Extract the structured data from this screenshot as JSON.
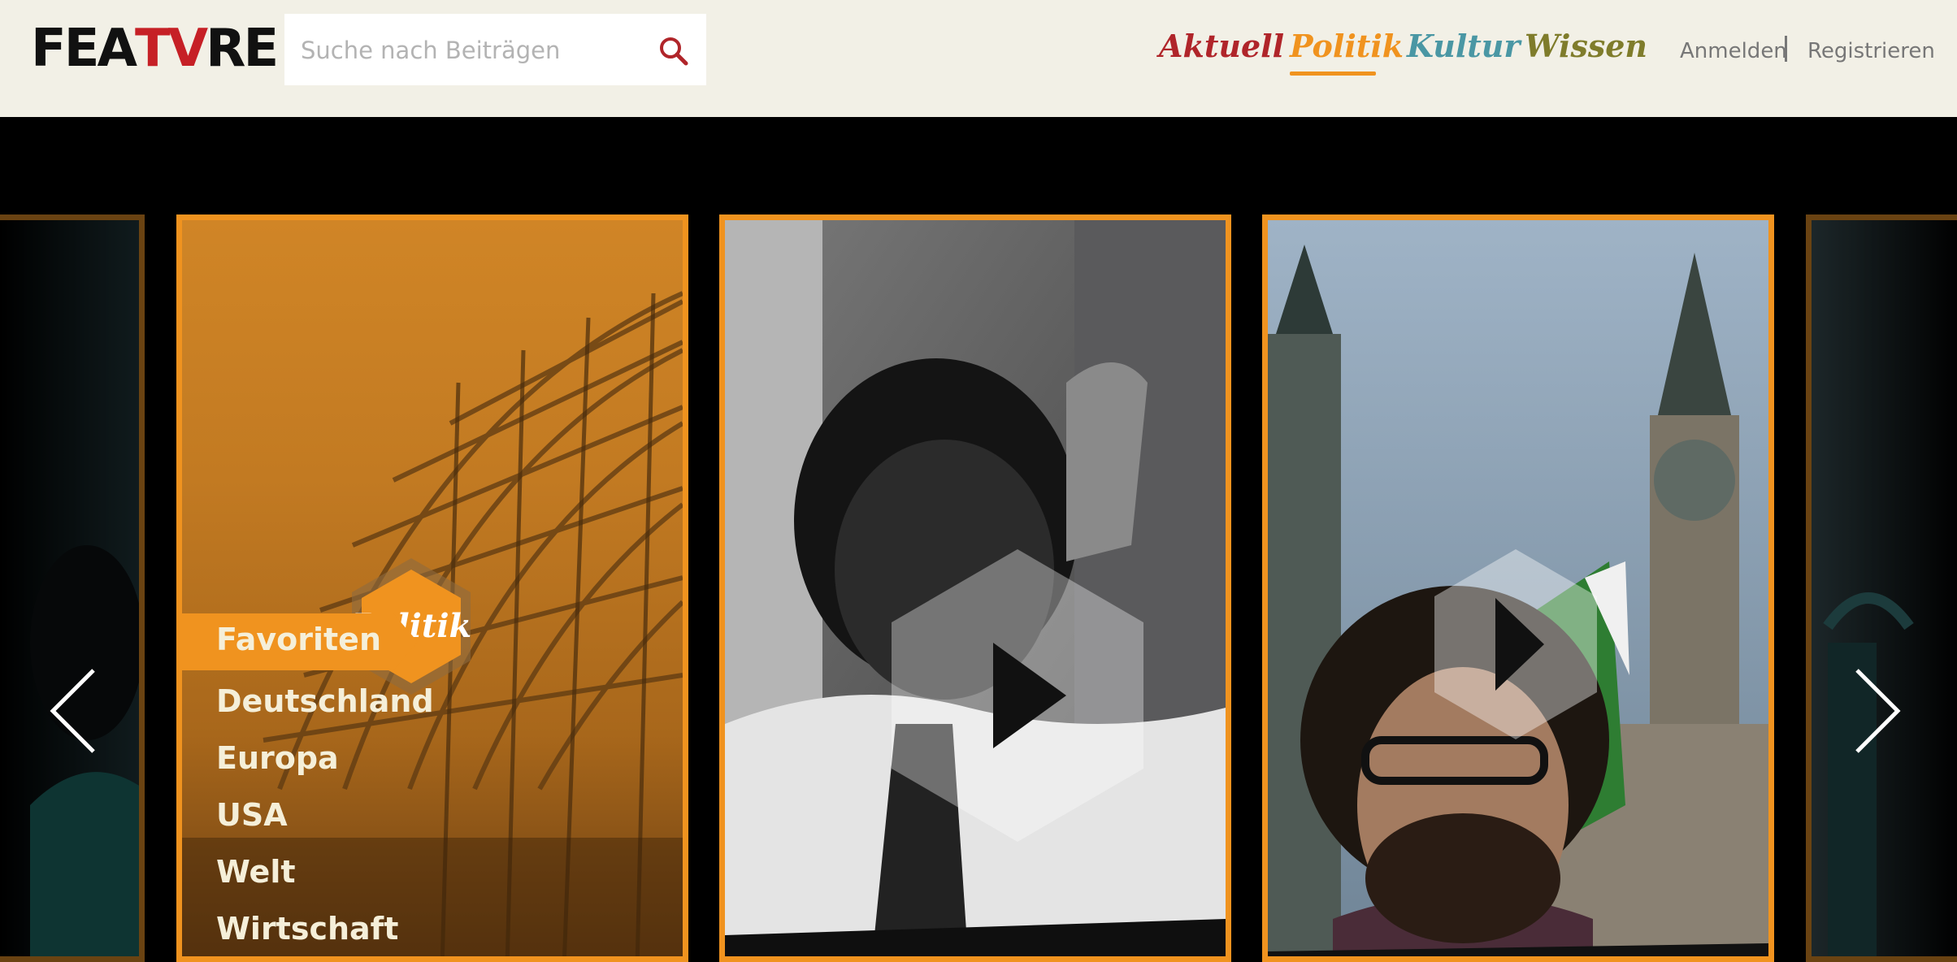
{
  "header": {
    "logo": {
      "part1": "FEA",
      "part2": "TV",
      "part3": "RE"
    },
    "search": {
      "placeholder": "Suche nach Beiträgen"
    },
    "nav": {
      "aktuell": "Aktuell",
      "politik": "Politik",
      "kultur": "Kultur",
      "wissen": "Wissen",
      "active": "Politik"
    },
    "auth": {
      "login": "Anmelden",
      "register": "Registrieren"
    }
  },
  "carousel": {
    "politik_card": {
      "badge": "Politik",
      "highlight": "Favoriten",
      "categories": [
        "Deutschland",
        "Europa",
        "USA",
        "Welt",
        "Wirtschaft"
      ]
    }
  },
  "colors": {
    "aktuell": "#b0252a",
    "politik": "#f0931f",
    "kultur": "#4a97a4",
    "wissen": "#7f7c2b",
    "header_bg": "#f2f0e6"
  },
  "icons": [
    "search-icon",
    "play-icon",
    "chevron-left-icon",
    "chevron-right-icon"
  ]
}
